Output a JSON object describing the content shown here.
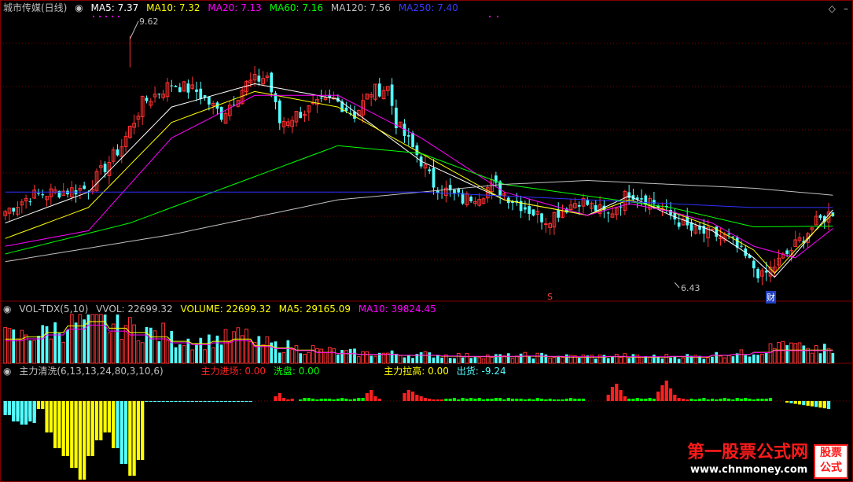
{
  "colors": {
    "up": "#ff3232",
    "down": "#54ffff",
    "ma5": "#ffffff",
    "ma10": "#ffff00",
    "ma20": "#ff00ff",
    "ma60": "#00ff00",
    "ma120": "#c0c0c0",
    "ma250": "#3030ff",
    "grid": "#800000",
    "yellow": "#ffff00",
    "green": "#00ff00",
    "red": "#ff2020"
  },
  "header": {
    "title": "城市传媒(日线)",
    "ma5": "MA5: 7.37",
    "ma10": "MA10: 7.32",
    "ma20": "MA20: 7.13",
    "ma60": "MA60: 7.16",
    "ma120": "MA120: 7.56",
    "ma250": "MA250: 7.40"
  },
  "vol_header": {
    "name": "VOL-TDX(5,10)",
    "vvol": "VVOL: 22699.32",
    "volume": "VOLUME: 22699.32",
    "ma5": "MA5: 29165.09",
    "ma10": "MA10: 39824.45"
  },
  "ind_header": {
    "name": "主力清洗(6,13,13,24,80,3,10,6)",
    "enter": "主力进场: 0.00",
    "wash": "洗盘: 0.00",
    "pull": "主力拉高: 0.00",
    "ship": "出货: -9.24"
  },
  "annotations": {
    "high": "9.62",
    "low": "6.43",
    "marker_s": "S",
    "marker_cai": "财"
  },
  "logo": {
    "title": "第一股票公式网",
    "url": "www.chnmoney.com",
    "badge_top": "股票",
    "badge_bottom": "公式"
  },
  "chart_data": [
    {
      "type": "candlestick",
      "title": "城市传媒(日线)",
      "ylim": [
        6.2,
        9.9
      ],
      "notable_points": {
        "high": 9.62,
        "low": 6.43
      },
      "close_path_x": [
        0,
        6,
        12,
        20,
        28,
        33,
        40,
        46,
        52,
        58,
        63,
        66,
        70,
        79,
        84,
        88,
        92,
        94,
        100,
        103,
        110,
        115,
        117,
        122,
        128,
        130,
        138,
        145,
        150,
        155,
        165,
        170,
        174,
        182,
        188,
        195,
        199
      ],
      "close_path_y": [
        7.35,
        7.55,
        7.6,
        7.65,
        8.2,
        8.75,
        9.0,
        8.9,
        8.6,
        9.0,
        9.1,
        8.5,
        8.6,
        8.8,
        8.6,
        8.9,
        8.95,
        8.5,
        8.0,
        7.7,
        7.5,
        7.6,
        7.7,
        7.5,
        7.3,
        7.25,
        7.5,
        7.3,
        7.6,
        7.5,
        7.1,
        7.05,
        7.0,
        6.5,
        6.8,
        7.2,
        7.35
      ],
      "ma": [
        {
          "name": "MA5",
          "x": [
            0,
            20,
            40,
            60,
            80,
            100,
            120,
            140,
            150,
            160,
            170,
            180,
            185,
            190,
            199
          ],
          "y": [
            7.2,
            7.6,
            8.7,
            9.0,
            8.8,
            8.0,
            7.5,
            7.3,
            7.55,
            7.3,
            7.1,
            6.75,
            6.5,
            6.8,
            7.37
          ]
        },
        {
          "name": "MA10",
          "x": [
            0,
            20,
            40,
            60,
            80,
            100,
            120,
            140,
            150,
            160,
            170,
            180,
            185,
            190,
            199
          ],
          "y": [
            7.0,
            7.4,
            8.5,
            8.9,
            8.7,
            8.1,
            7.5,
            7.3,
            7.5,
            7.35,
            7.15,
            6.85,
            6.55,
            6.85,
            7.32
          ]
        },
        {
          "name": "MA20",
          "x": [
            0,
            20,
            40,
            60,
            80,
            100,
            120,
            140,
            150,
            160,
            170,
            180,
            190,
            199
          ],
          "y": [
            6.9,
            7.1,
            8.3,
            8.85,
            8.85,
            8.3,
            7.6,
            7.3,
            7.45,
            7.35,
            7.2,
            6.9,
            6.75,
            7.13
          ]
        },
        {
          "name": "MA60",
          "x": [
            0,
            30,
            60,
            80,
            100,
            120,
            140,
            160,
            180,
            199
          ],
          "y": [
            6.8,
            7.2,
            7.8,
            8.2,
            8.1,
            7.7,
            7.55,
            7.4,
            7.15,
            7.16
          ]
        },
        {
          "name": "MA120",
          "x": [
            0,
            40,
            80,
            100,
            120,
            140,
            160,
            180,
            199
          ],
          "y": [
            6.7,
            7.05,
            7.5,
            7.6,
            7.7,
            7.75,
            7.7,
            7.65,
            7.56
          ]
        },
        {
          "name": "MA250",
          "x": [
            0,
            40,
            80,
            100,
            120,
            140,
            160,
            180,
            199
          ],
          "y": [
            7.6,
            7.6,
            7.6,
            7.6,
            7.55,
            7.5,
            7.45,
            7.4,
            7.4
          ]
        }
      ]
    },
    {
      "type": "bar",
      "title": "VOL-TDX(5,10)",
      "series": [
        {
          "name": "VOLUME",
          "value": 22699.32
        },
        {
          "name": "MA5",
          "value": 29165.09
        },
        {
          "name": "MA10",
          "value": 39824.45
        }
      ]
    },
    {
      "type": "bar",
      "title": "主力清洗(6,13,13,24,80,3,10,6)",
      "series": [
        {
          "name": "主力进场",
          "value": 0.0
        },
        {
          "name": "洗盘",
          "value": 0.0
        },
        {
          "name": "主力拉高",
          "value": 0.0
        },
        {
          "name": "出货",
          "value": -9.24
        }
      ]
    }
  ]
}
